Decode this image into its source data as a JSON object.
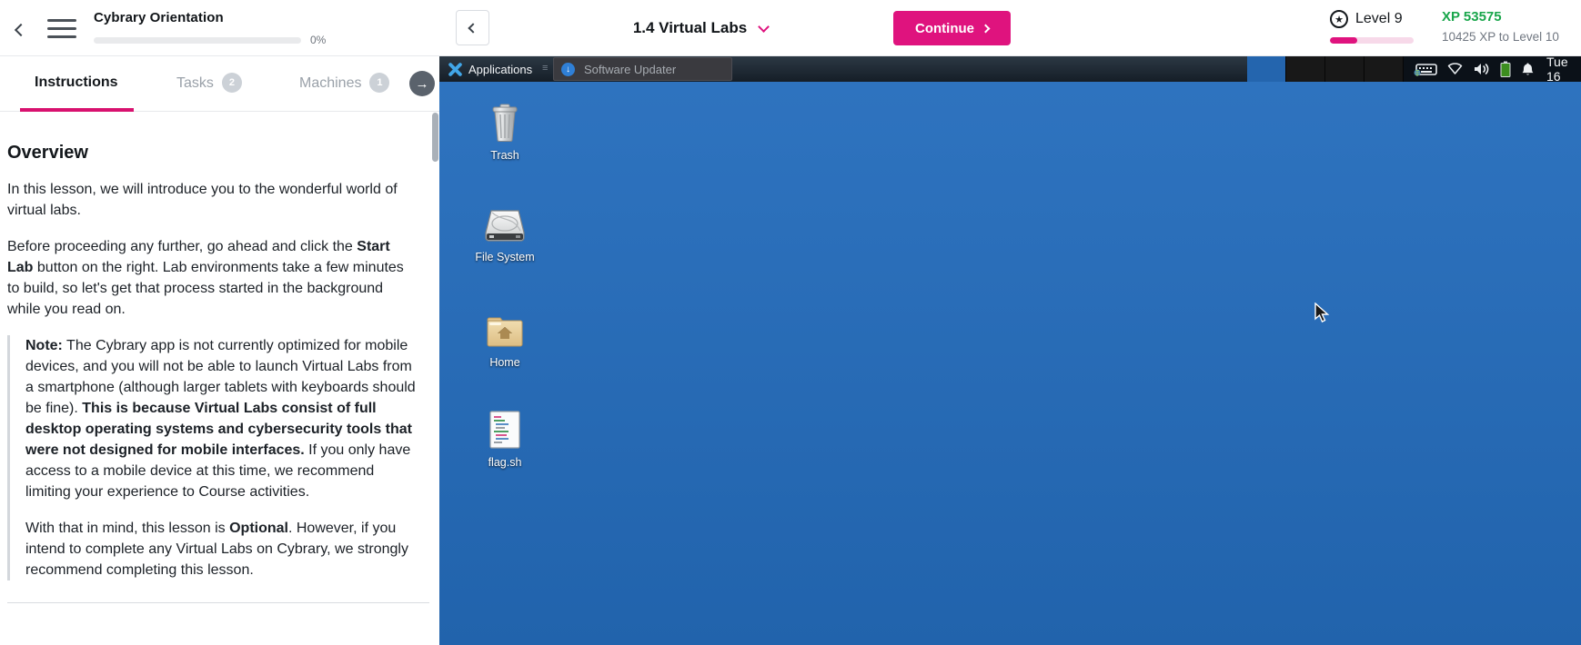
{
  "header": {
    "course_title": "Cybrary Orientation",
    "progress_percent": "0%",
    "lesson_title": "1.4 Virtual Labs",
    "continue_label": "Continue",
    "level_label": "Level 9",
    "xp_value": "XP 53575",
    "xp_to_next": "10425 XP to Level 10"
  },
  "tabs": {
    "items": [
      {
        "label": "Instructions",
        "badge": ""
      },
      {
        "label": "Tasks",
        "badge": "2"
      },
      {
        "label": "Machines",
        "badge": "1"
      }
    ]
  },
  "panel": {
    "heading": "Overview",
    "p1": "In this lesson, we will introduce you to the wonderful world of virtual labs.",
    "p2_pre": "Before proceeding any further, go ahead and click the ",
    "p2_bold": "Start Lab",
    "p2_post": " button on the right. Lab environments take a few minutes to build, so let's get that process started in the background while you read on.",
    "note_bold1": "Note:",
    "note_text1": " The Cybrary app is not currently optimized for mobile devices, and you will not be able to launch Virtual Labs from a smartphone (although larger tablets with keyboards should be fine). ",
    "note_bold2": "This is because Virtual Labs consist of full desktop operating systems and cybersecurity tools that were not designed for mobile interfaces.",
    "note_text2": " If you only have access to a mobile device at this time, we recommend limiting your experience to Course activities.",
    "p4_pre": "With that in mind, this lesson is ",
    "p4_bold": "Optional",
    "p4_post": ". However, if you intend to complete any Virtual Labs on Cybrary, we strongly recommend completing this lesson."
  },
  "desktop": {
    "taskbar": {
      "menu_label": "Applications",
      "window_label": "Software Updater",
      "clock": "Tue 16"
    },
    "icons": [
      {
        "label": "Trash"
      },
      {
        "label": "File System"
      },
      {
        "label": "Home"
      },
      {
        "label": "flag.sh"
      }
    ]
  },
  "colors": {
    "accent_pink": "#df137e",
    "xp_green": "#19a64b",
    "desktop_blue": "#2465ae",
    "taskbar_dark": "#1b242e"
  }
}
